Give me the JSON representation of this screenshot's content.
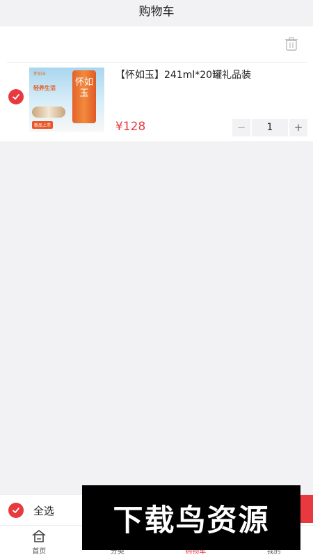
{
  "header": {
    "title": "购物车"
  },
  "cart": {
    "items": [
      {
        "title": "【怀如玉】241ml*20罐礼品装",
        "price": "¥128",
        "quantity": "1",
        "selected": true,
        "thumbnail": {
          "brand": "怀如玉",
          "slogan": "轻养生活",
          "subtext": "",
          "can_text": "怀如玉",
          "badge": "新品上市",
          "note": ""
        }
      }
    ],
    "stepper": {
      "minus": "−",
      "plus": "+"
    }
  },
  "bottom_bar": {
    "select_all_label": "全选"
  },
  "tabbar": {
    "tabs": [
      {
        "label": "首页",
        "icon": "home-icon"
      },
      {
        "label": "分类",
        "icon": "category-icon"
      },
      {
        "label": "购物车",
        "icon": "cart-icon",
        "active": true
      },
      {
        "label": "我的",
        "icon": "profile-icon"
      }
    ]
  },
  "watermark": {
    "text": "下载鸟资源"
  },
  "colors": {
    "accent": "#e8393f",
    "background": "#f2f2f4"
  }
}
